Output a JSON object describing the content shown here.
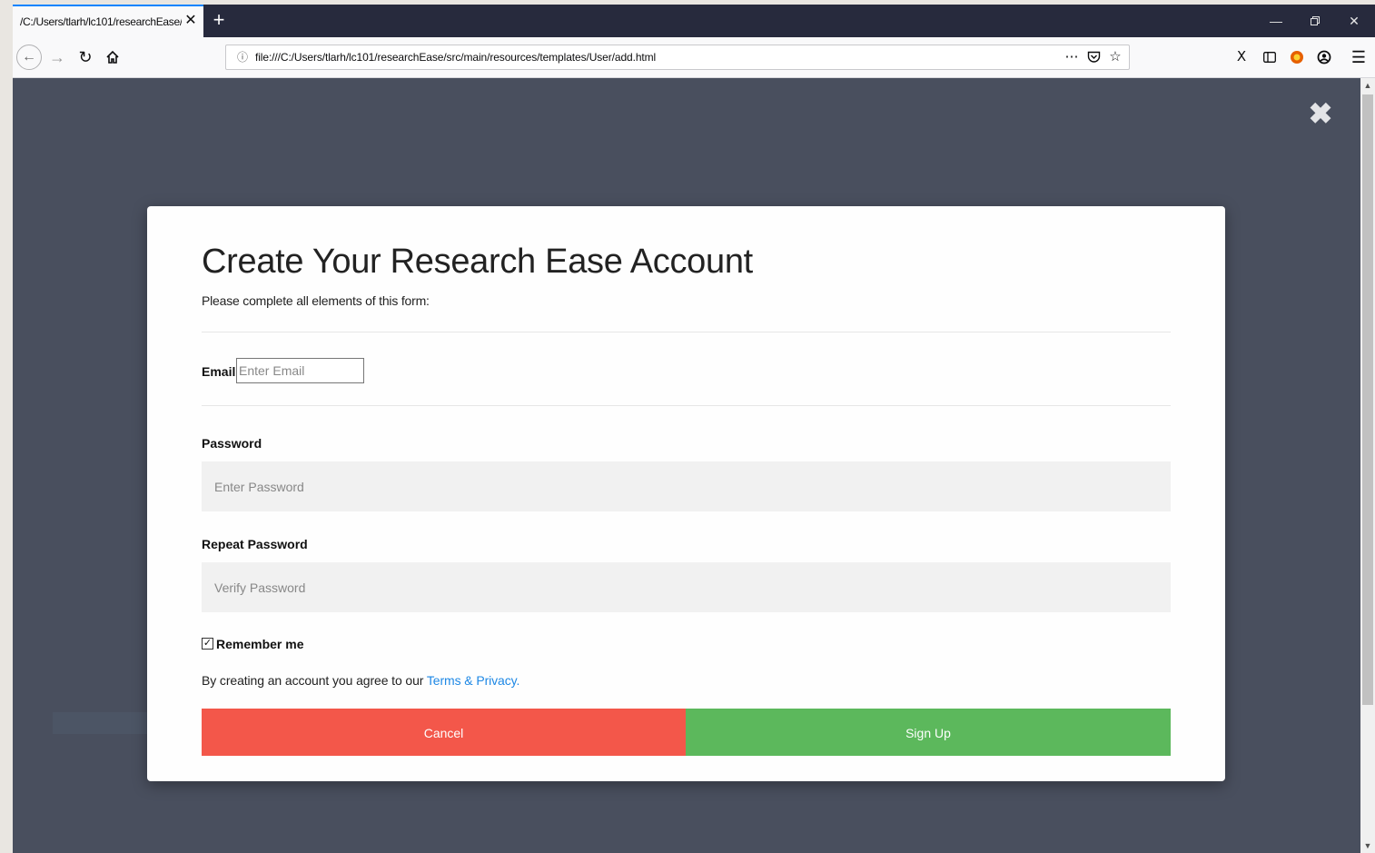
{
  "browser": {
    "tab_title": "/C:/Users/tlarh/lc101/researchEase/",
    "tab_close": "✕",
    "new_tab": "+",
    "url": "file:///C:/Users/tlarh/lc101/researchEase/src/main/resources/templates/User/add.html",
    "icons": {
      "back": "arrow-left-icon",
      "forward": "arrow-right-icon",
      "reload": "reload-icon",
      "home": "home-icon",
      "info": "info-icon",
      "page_actions": "ellipsis-icon",
      "pocket": "pocket-icon",
      "bookmark": "star-icon",
      "library": "library-icon",
      "sidebar": "sidebar-icon",
      "extension": "extension-icon",
      "account": "account-icon",
      "menu": "hamburger-menu-icon"
    }
  },
  "modal": {
    "title": "Create Your Research Ease Account",
    "subtitle": "Please complete all elements of this form:",
    "email": {
      "label": "Email",
      "placeholder": "Enter Email",
      "value": ""
    },
    "password": {
      "label": "Password",
      "placeholder": "Enter Password",
      "value": ""
    },
    "repeat_password": {
      "label": "Repeat Password",
      "placeholder": "Verify Password",
      "value": ""
    },
    "remember": {
      "label": "Remember me",
      "checked": true
    },
    "terms_text": "By creating an account you agree to our ",
    "terms_link": "Terms & Privacy",
    "terms_end": ".",
    "cancel_label": "Cancel",
    "signup_label": "Sign Up",
    "close_icon": "close-icon"
  },
  "colors": {
    "overlay": "#494f5e",
    "cancel": "#f3574a",
    "signup": "#5cb85c",
    "link": "#1e88e5",
    "tabbar": "#272a3d",
    "tab_accent": "#0a84ff"
  }
}
